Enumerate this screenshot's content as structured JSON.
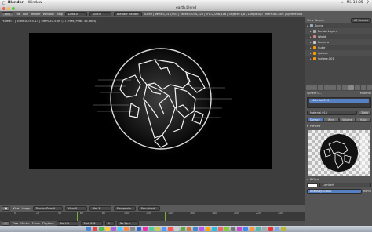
{
  "mac_menu": {
    "app": "Blender",
    "items": [
      "Window"
    ],
    "clock": "Mi. 19:05"
  },
  "title": "earth.blend",
  "info_bar": {
    "editor_type": "Info",
    "menus": [
      "File",
      "Add",
      "Render",
      "Window",
      "Help"
    ],
    "layout": "Default",
    "scene": "Scene",
    "engine": "Blender Render",
    "stats": "v2.69 | Verts:1,010,001 | Faces:1,034,320 | Tris:2,068,416 | Objects:1/8 | Lamps:0/0 | Mem:48.35M | Sphere.001"
  },
  "render_header": "Frame:1 | Time:00:05.13 | Mem:20.53M (37.76M, Peak 38.98M)",
  "outliner": {
    "view": "View",
    "search": "Search",
    "scope": "All Scenes",
    "items": [
      {
        "label": "Scene",
        "icon_color": "#9ab"
      },
      {
        "label": "RenderLayers",
        "icon_color": "#aaa"
      },
      {
        "label": "World",
        "icon_color": "#c88"
      },
      {
        "label": "Camera",
        "icon_color": "#ccc"
      },
      {
        "label": "Cube",
        "icon_color": "#f90"
      },
      {
        "label": "Sphere",
        "icon_color": "#f90"
      },
      {
        "label": "Sphere.001",
        "icon_color": "#f90"
      }
    ]
  },
  "properties": {
    "breadcrumb": "Sphere.0...",
    "breadcrumb_mat": "Material",
    "material_name": "Material.014",
    "data_label": "Data",
    "shading_tabs": [
      "Surface",
      "Wire",
      "Volume",
      "Halo"
    ],
    "preview_label": "Preview",
    "diffuse_label": "Diffuse",
    "shader": "Lambert",
    "intensity": "Intensity: 0.800",
    "ramp": "Ramp"
  },
  "image_editor_header": {
    "items": [
      "View",
      "Image"
    ],
    "image": "Render Result",
    "slot": "Slot 1",
    "view": "View 0",
    "layer": "Composite",
    "pass": "Combined"
  },
  "timeline": {
    "ticks": [
      "0",
      "20",
      "40",
      "60",
      "80",
      "100",
      "120",
      "140",
      "160",
      "180",
      "200",
      "220",
      "240"
    ],
    "menus": [
      "View",
      "Marker",
      "Frame",
      "Playback"
    ],
    "start": "Start: 1",
    "end": "End: 250",
    "current": "1",
    "sync": "No Sync"
  },
  "dock_colors": [
    "#4a8ad4",
    "#e44",
    "#5b5",
    "#fc3",
    "#a6d",
    "#4cf",
    "#f84",
    "#888",
    "#36c",
    "#e3a",
    "#5c9",
    "#cc5",
    "#59f",
    "#f55",
    "#ccc",
    "#6a4",
    "#d73",
    "#48c",
    "#b5e",
    "#fa0",
    "#3bd",
    "#e66",
    "#8c3",
    "#777",
    "#c4c",
    "#48e",
    "#f93",
    "#5ba",
    "#aaa",
    "#e33",
    "#7ae",
    "#bb3"
  ]
}
